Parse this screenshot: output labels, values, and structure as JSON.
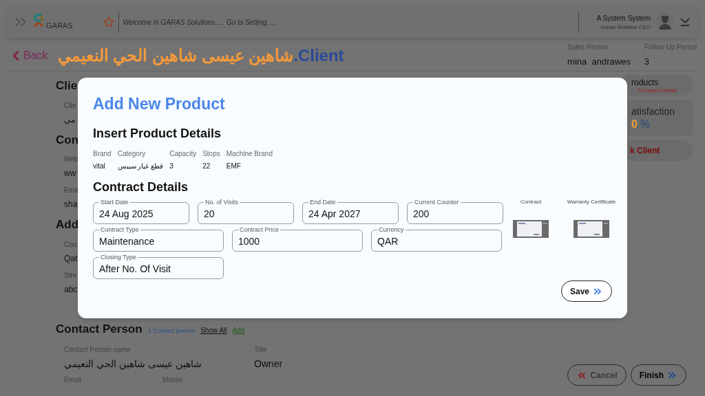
{
  "header": {
    "logo_text": "GARAS",
    "welcome": "Welcome in GARAS Solutions..... Go to Setting.....",
    "user_name": "A System System",
    "user_role": "Garas Solution CEO"
  },
  "title_bar": {
    "back": "Back",
    "client_name": "شاهين عيسى شاهين الحي النعيمي",
    "separator": ".",
    "client_label": "Client"
  },
  "sales": [
    {
      "label": "Sales Person",
      "value": "mina  andrawes"
    },
    {
      "label": "Follow Up Period",
      "value": "3"
    }
  ],
  "left_fragments": [
    {
      "kind": "heading",
      "text": "Clie"
    },
    {
      "kind": "label",
      "text": "Clie"
    },
    {
      "kind": "value",
      "text": "مي"
    },
    {
      "kind": "heading",
      "text": "Con"
    },
    {
      "kind": "label",
      "text": "Web"
    },
    {
      "kind": "value",
      "text": "ww"
    },
    {
      "kind": "label",
      "text": "Ema"
    },
    {
      "kind": "value",
      "text": "sha"
    },
    {
      "kind": "heading",
      "text": "Add"
    },
    {
      "kind": "label",
      "text": "Cou"
    },
    {
      "kind": "value",
      "text": "Qat"
    },
    {
      "kind": "label",
      "text": "Stre"
    },
    {
      "kind": "value",
      "text": "abc"
    }
  ],
  "cards": [
    {
      "kind": "products",
      "title": "roducts",
      "open": "t",
      "closed": "0 Closed Contract"
    },
    {
      "kind": "satisfaction",
      "title": "atisfaction",
      "number": "0",
      "unit": "%"
    },
    {
      "kind": "action",
      "title": "k Client"
    }
  ],
  "modal": {
    "title": "Add New Product",
    "product_heading": "Insert Product Details",
    "product_columns": [
      {
        "label": "Brand",
        "value": "vital"
      },
      {
        "label": "Category",
        "value": "قطع غيار سيبس"
      },
      {
        "label": "Capacity",
        "value": "3"
      },
      {
        "label": "Stops",
        "value": "22"
      },
      {
        "label": "Machine Brand",
        "value": "EMF"
      }
    ],
    "contract_heading": "Contract Details",
    "field_rows": [
      [
        {
          "label": "Start Date",
          "value": "24 Aug 2025"
        },
        {
          "label": "No. of Visits",
          "value": "20"
        },
        {
          "label": "End Date",
          "value": "24 Apr 2027"
        },
        {
          "label": "Current Counter",
          "value": "200"
        }
      ],
      [
        {
          "label": "Contract Type",
          "value": "Maintenance"
        },
        {
          "label": "Contract Price",
          "value": "1000"
        },
        {
          "label": "Currency",
          "value": "QAR"
        }
      ],
      [
        {
          "label": "Closing Type",
          "value": "After No. Of Visit"
        }
      ]
    ],
    "attachments": [
      {
        "label": "Contract"
      },
      {
        "label": "Warranty Certificate"
      }
    ],
    "save": "Save"
  },
  "contact": {
    "heading": "Contact Person",
    "count": "1 Contact person",
    "show_all": "Show All",
    "add": "Add",
    "fields": [
      {
        "label": "Contact Person name",
        "value": "شاهين عيسى شاهين الحي النعيمي"
      },
      {
        "label": "Title",
        "value": "Owner"
      }
    ],
    "more_labels": [
      "Email",
      "Mobile"
    ]
  },
  "footer": [
    {
      "kind": "cancel",
      "label": "Cancel",
      "disabled": true
    },
    {
      "kind": "finish",
      "label": "Finish",
      "disabled": false
    }
  ]
}
